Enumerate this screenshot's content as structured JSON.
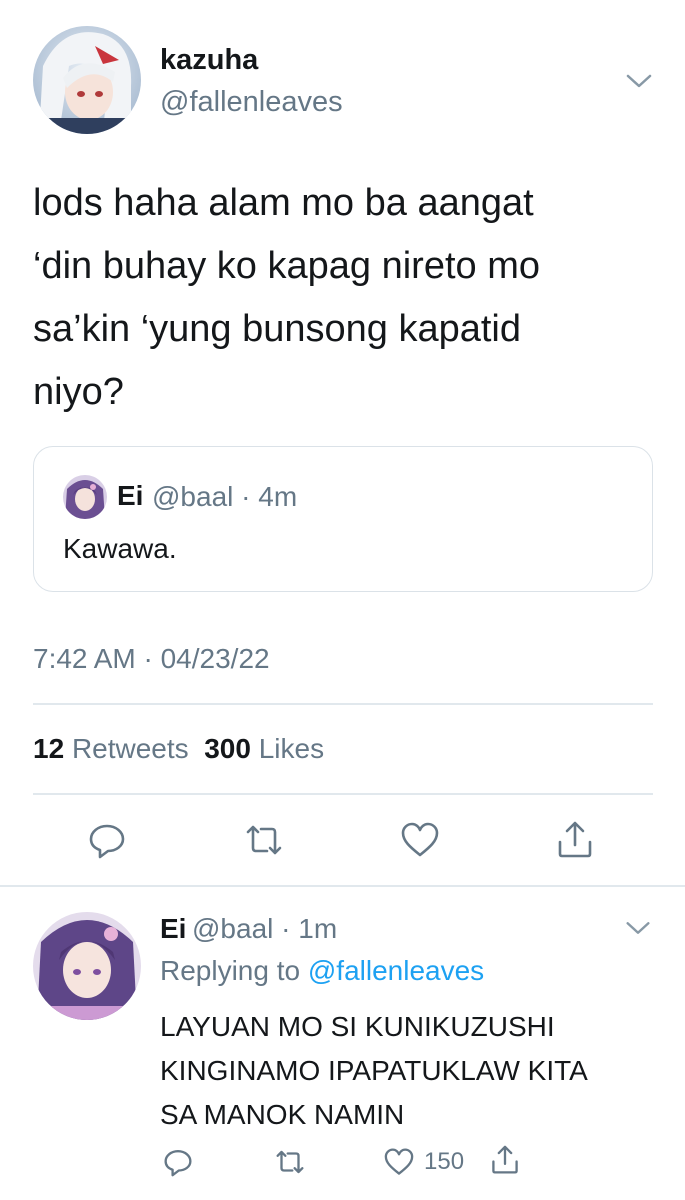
{
  "tweet": {
    "author_name": "kazuha",
    "author_handle": "@fallenleaves",
    "text_lines": [
      "lods haha alam mo ba aangat",
      "‘din buhay ko kapag nireto mo",
      "sa’kin ‘yung bunsong kapatid",
      "niyo?"
    ],
    "timestamp": "7:42 AM · 04/23/22",
    "retweet_count": "12",
    "retweet_label": "Retweets",
    "like_count": "300",
    "like_label": "Likes"
  },
  "quote": {
    "author_name": "Ei",
    "author_handle": "@baal · 4m",
    "text": "Kawawa."
  },
  "reply": {
    "author_name": "Ei",
    "author_handle": "@baal · 1m",
    "replying_prefix": "Replying to ",
    "replying_to": "@fallenleaves",
    "text_lines": [
      "LAYUAN MO SI KUNIKUZUSHI",
      "KINGINAMO IPAPATUKLAW KITA",
      "SA MANOK NAMIN"
    ],
    "like_count": "150"
  },
  "icons": {
    "reply": "reply-icon",
    "retweet": "retweet-icon",
    "like": "heart-icon",
    "share": "share-icon",
    "more": "chevron-down-icon"
  },
  "colors": {
    "text": "#14171a",
    "secondary": "#657786",
    "link": "#1da1f2",
    "divider": "#e1e8ed"
  }
}
